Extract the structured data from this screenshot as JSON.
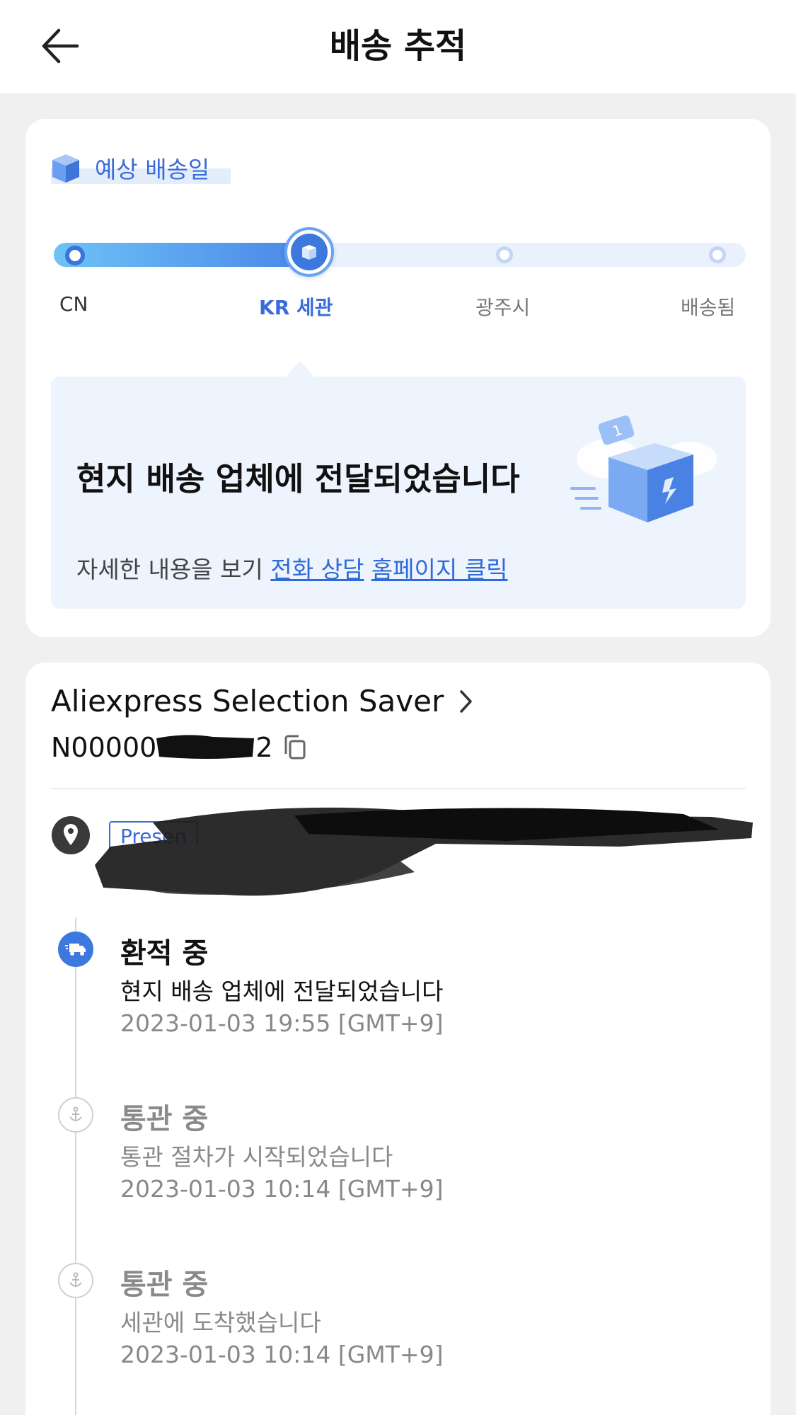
{
  "header": {
    "title": "배송 추적"
  },
  "eta": {
    "label": "예상 배송일"
  },
  "progress": {
    "fraction": 0.33,
    "stages": [
      {
        "label": "CN",
        "state": "done"
      },
      {
        "label": "KR 세관",
        "state": "current"
      },
      {
        "label": "광주시",
        "state": "pending"
      },
      {
        "label": "배송됨",
        "state": "pending"
      }
    ]
  },
  "status": {
    "title": "현지 배송 업체에 전달되었습니다",
    "help_prefix": "자세한 내용을 보기",
    "link_phone": "전화 상담",
    "link_homepage": "홈페이지 클릭"
  },
  "carrier": {
    "name": "Aliexpress Selection Saver",
    "tracking_number": "N00000",
    "tracking_suffix": "2"
  },
  "address": {
    "tag": "Presen"
  },
  "events": [
    {
      "title": "환적 중",
      "desc": "현지 배송 업체에 전달되었습니다",
      "time": "2023-01-03 19:55 [GMT+9]",
      "icon": "truck-icon",
      "active": true
    },
    {
      "title": "통관 중",
      "desc": "통관 절차가 시작되었습니다",
      "time": "2023-01-03 10:14 [GMT+9]",
      "icon": "anchor-icon",
      "active": false
    },
    {
      "title": "통관 중",
      "desc": "세관에 도착했습니다",
      "time": "2023-01-03 10:14 [GMT+9]",
      "icon": "anchor-icon",
      "active": false
    }
  ],
  "colors": {
    "accent": "#3b6bd8",
    "background": "#f0f0f0",
    "status_box": "#eef4fd"
  }
}
